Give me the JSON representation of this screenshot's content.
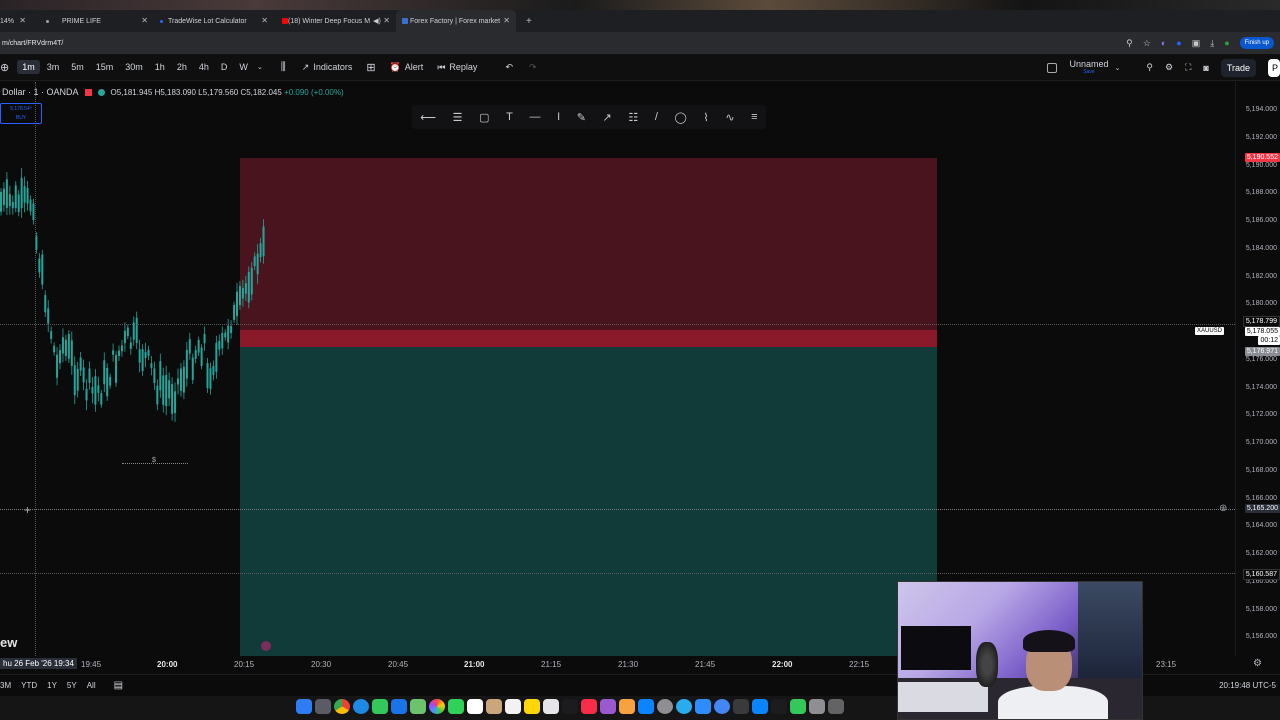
{
  "browser": {
    "tabs": [
      {
        "label": "14%",
        "color": "#9aa0a6"
      },
      {
        "label": "PRIME LIFE",
        "color": "#9aa0a6"
      },
      {
        "label": "TradeWise Lot Calculator",
        "color": "#2962ff"
      },
      {
        "label": "(18) Winter Deep Focus M",
        "color": "#ff0000"
      },
      {
        "label": "Forex Factory | Forex market",
        "color": "#3b6fd1"
      }
    ],
    "new_tab": "+",
    "url": "m/chart/FRVdrm4T/",
    "finish_update": "Finish up"
  },
  "toolbar": {
    "timeframes": [
      "1m",
      "3m",
      "5m",
      "15m",
      "30m",
      "1h",
      "2h",
      "4h",
      "D",
      "W"
    ],
    "active_timeframe": "1m",
    "indicators": "Indicators",
    "alert": "Alert",
    "replay": "Replay",
    "layout_name": "Unnamed",
    "layout_status": "Save",
    "trade": "Trade",
    "publish": "P"
  },
  "legend": {
    "symbol": "Dollar · 1 · OANDA",
    "open": "O5,181.945",
    "high": "H5,183.090",
    "low": "L5,179.560",
    "close": "C5,182.045",
    "change": "+0.090 (+0.00%)"
  },
  "order_box": {
    "price": "5,178.54⁰",
    "side": "BUY"
  },
  "price_scale": {
    "ticks": [
      "5,194.000",
      "5,192.000",
      "5,190.000",
      "5,188.000",
      "5,186.000",
      "5,184.000",
      "5,182.000",
      "5,180.000",
      "5,178.000",
      "5,176.000",
      "5,174.000",
      "5,172.000",
      "5,170.000",
      "5,168.000",
      "5,166.000",
      "5,164.000",
      "5,162.000",
      "5,160.000",
      "5,158.000",
      "5,156.000"
    ],
    "stop_label": "5,190.552",
    "price_label_1": "5,178.799",
    "last_price": "5,178.055",
    "countdown": "00:12",
    "entry_label": "5,176.971",
    "crosshair_price": "5,165.200",
    "target_label": "5,160.587",
    "symbol_tag": "XAUUSD"
  },
  "time_scale": {
    "cursor": "hu 26 Feb '26   19:34",
    "ticks": [
      {
        "label": "19:45",
        "bold": false
      },
      {
        "label": "20:00",
        "bold": true
      },
      {
        "label": "20:15",
        "bold": false
      },
      {
        "label": "20:30",
        "bold": false
      },
      {
        "label": "20:45",
        "bold": false
      },
      {
        "label": "21:00",
        "bold": true
      },
      {
        "label": "21:15",
        "bold": false
      },
      {
        "label": "21:30",
        "bold": false
      },
      {
        "label": "21:45",
        "bold": false
      },
      {
        "label": "22:00",
        "bold": true
      },
      {
        "label": "22:15",
        "bold": false
      },
      {
        "label": "23:15",
        "bold": false
      }
    ]
  },
  "bottom": {
    "ranges": [
      "3M",
      "YTD",
      "1Y",
      "5Y",
      "All"
    ],
    "clock": "20:19:48 UTC-5"
  },
  "logo_text": "ew",
  "drawing_marker": "$",
  "colors": {
    "up": "#26a69a",
    "stop_zone": "#4a141e",
    "target_zone": "#103b38",
    "price_red": "#f23645"
  }
}
